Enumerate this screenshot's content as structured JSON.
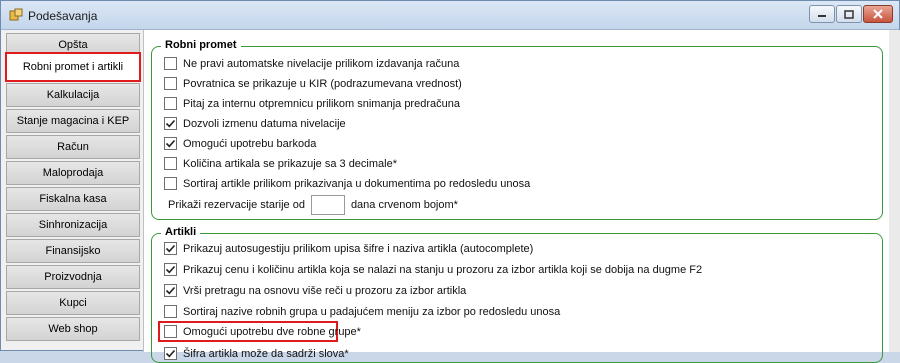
{
  "window": {
    "title": "Podešavanja"
  },
  "sidebar": {
    "items": [
      {
        "label": "Opšta"
      },
      {
        "label": "Robni promet i artikli",
        "selected": true
      },
      {
        "label": "Kalkulacija"
      },
      {
        "label": "Stanje magacina i KEP"
      },
      {
        "label": "Račun"
      },
      {
        "label": "Maloprodaja"
      },
      {
        "label": "Fiskalna kasa"
      },
      {
        "label": "Sinhronizacija"
      },
      {
        "label": "Finansijsko"
      },
      {
        "label": "Proizvodnja"
      },
      {
        "label": "Kupci"
      },
      {
        "label": "Web shop"
      }
    ]
  },
  "robni_promet": {
    "title": "Robni promet",
    "options": [
      {
        "label": "Ne pravi automatske nivelacije prilikom izdavanja računa",
        "checked": false
      },
      {
        "label": "Povratnica se prikazuje u KIR (podrazumevana vrednost)",
        "checked": false
      },
      {
        "label": "Pitaj za internu otpremnicu prilikom snimanja predračuna",
        "checked": false
      },
      {
        "label": "Dozvoli izmenu datuma nivelacije",
        "checked": true
      },
      {
        "label": "Omogući upotrebu barkoda",
        "checked": true
      },
      {
        "label": "Količina artikala se prikazuje sa 3 decimale*",
        "checked": false
      },
      {
        "label": "Sortiraj artikle prilikom prikazivanja u dokumentima po redosledu unosa",
        "checked": false
      }
    ],
    "reservation": {
      "prefix": "Prikaži rezervacije starije od",
      "value": "",
      "suffix": "dana crvenom bojom*"
    }
  },
  "artikli": {
    "title": "Artikli",
    "options": [
      {
        "label": "Prikazuj autosugestiju prilikom upisa šifre i naziva artikla (autocomplete)",
        "checked": true
      },
      {
        "label": "Prikazuj cenu i količinu artikla koja se nalazi na stanju u prozoru za izbor artikla koji se dobija na dugme F2",
        "checked": true
      },
      {
        "label": "Vrši pretragu na osnovu više reči u prozoru za izbor artikla",
        "checked": true
      },
      {
        "label": "Sortiraj nazive robnih grupa u padajućem meniju za izbor po redosledu unosa",
        "checked": false
      },
      {
        "label": "Omogući upotrebu dve robne grupe*",
        "checked": false,
        "highlighted": true
      },
      {
        "label": "Šifra artikla može da sadrži slova*",
        "checked": true
      }
    ]
  },
  "colors": {
    "highlight": "#e01b1b",
    "group_border": "#3a9a3a"
  }
}
